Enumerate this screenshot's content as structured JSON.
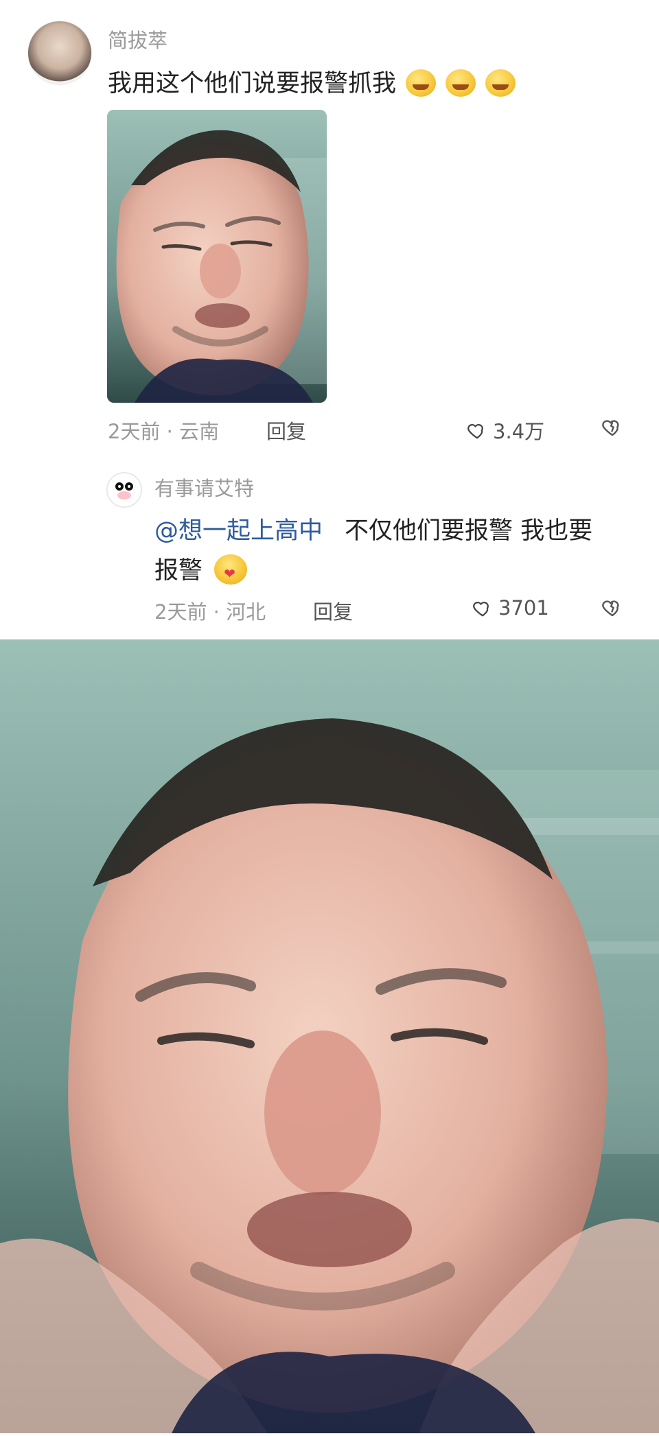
{
  "comment": {
    "author": "简拔萃",
    "text": "我用这个他们说要报警抓我",
    "emojis": [
      "crying-laughing-emoji",
      "crying-laughing-emoji",
      "crying-laughing-emoji"
    ],
    "meta": "2天前 · 云南",
    "reply_label": "回复",
    "likes": "3.4万"
  },
  "reply": {
    "author": "有事请艾特",
    "mention": "@想一起上高中",
    "text_line1": "不仅他们要报警 我也要",
    "text_line2": "报警",
    "emoji": "hug-heart-emoji",
    "meta": "2天前 · 河北",
    "reply_label": "回复",
    "likes": "3701"
  },
  "colors": {
    "mention": "#2d5b9d",
    "meta": "#9a9a9a",
    "text": "#222222"
  }
}
